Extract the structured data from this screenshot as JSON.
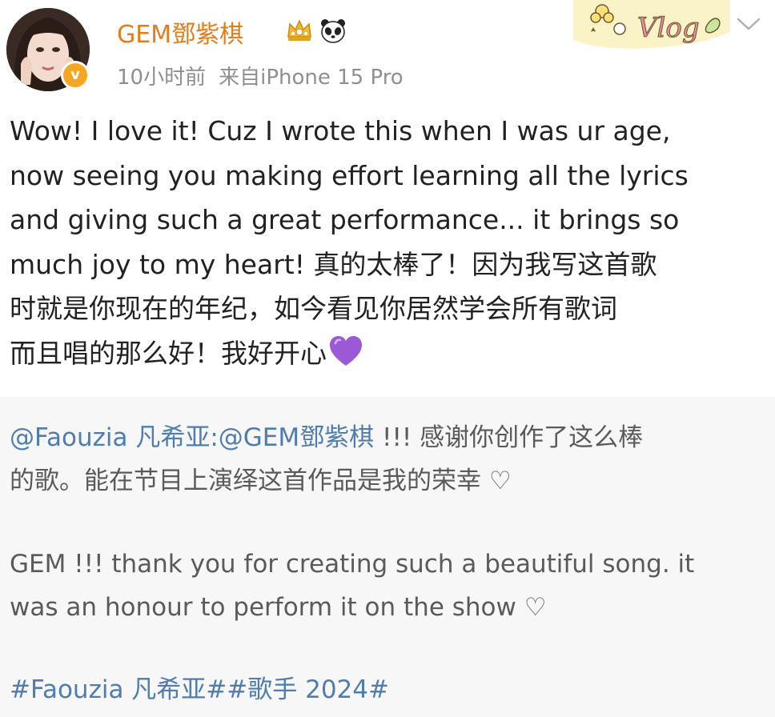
{
  "post": {
    "username": "GEM鄧紫棋",
    "time": "10小时前",
    "source": "来自iPhone 15 Pro",
    "verified_badge": "v",
    "sticker_text": "Vlog",
    "icons": [
      "crown-icon",
      "panda-icon",
      "chevron-down-icon",
      "purple-heart-icon"
    ],
    "text_lines": [
      "Wow! I love it! Cuz I wrote this when I was ur age,",
      "now seeing you making effort learning all the lyrics",
      "and giving such a great performance... it brings so",
      "much joy to my heart!  真的太棒了！因为我写这首歌",
      "时就是你现在的年纪，如今看见你居然学会所有歌词",
      "而且唱的那么好！我好开心"
    ]
  },
  "repost": {
    "mention_user": "@Faouzia 凡希亚",
    "mention_target": ":@GEM鄧紫棋",
    "cn_line1_rest": " !!! 感谢你创作了这么棒",
    "cn_line2": "的歌。能在节目上演绎这首作品是我的荣幸 ♡",
    "en_line1": "GEM !!! thank you for creating such a beautiful song. it",
    "en_line2": "was an honour to perform it on the show ♡",
    "hashtags": "#Faouzia 凡希亚##歌手 2024#"
  },
  "colors": {
    "username": "#e37d1c",
    "meta": "#8f8f8f",
    "body_text": "#222222",
    "repost_bg": "#f7f7f7",
    "repost_text": "#5a5a5a",
    "link": "#4f7cb1",
    "badge": "#f5a623",
    "heart": "#9b59d6"
  }
}
